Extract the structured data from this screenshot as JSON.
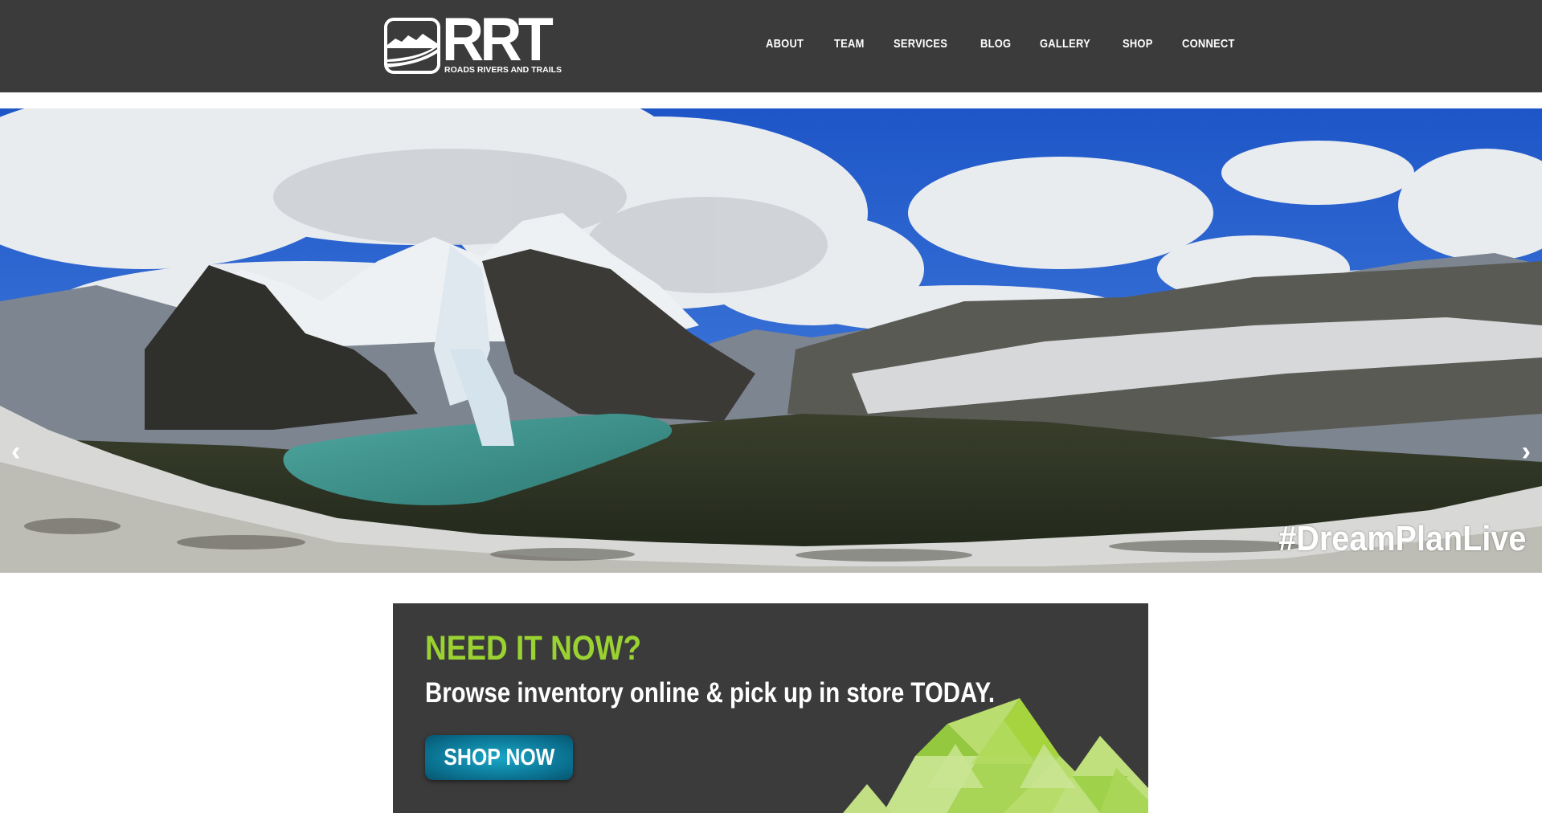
{
  "header": {
    "logo_text": "RRT",
    "logo_subtext": "ROADS RIVERS AND TRAILS",
    "nav": [
      "ABOUT",
      "TEAM",
      "SERVICES",
      "BLOG",
      "GALLERY",
      "SHOP",
      "CONNECT"
    ]
  },
  "hero": {
    "hashtag": "#DreamPlanLive",
    "prev_icon": "chevron-left-icon",
    "next_icon": "chevron-right-icon",
    "prev_glyph": "‹",
    "next_glyph": "›"
  },
  "promo": {
    "title": "NEED IT NOW?",
    "subtitle": "Browse inventory online & pick up in store TODAY.",
    "button_label": "SHOP NOW"
  },
  "colors": {
    "header_bg": "#3b3b3b",
    "accent_green": "#9ad232",
    "button_teal": "#0a6f8e"
  }
}
